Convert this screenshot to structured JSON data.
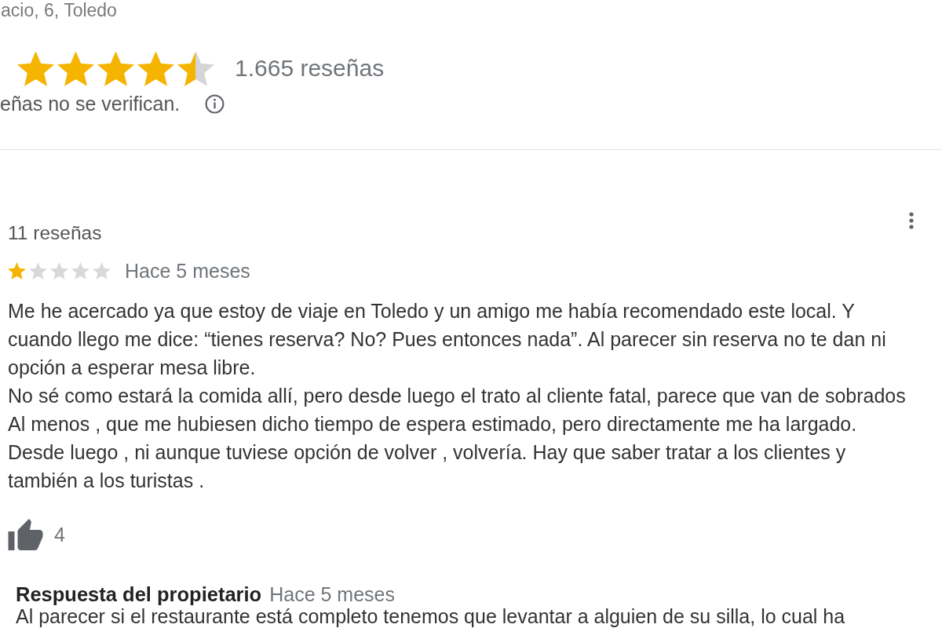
{
  "place_header": {
    "address": "acio, 6, Toledo",
    "stars": 4.5,
    "review_count": "1.665 reseñas",
    "notice": "eñas no se verifican."
  },
  "review": {
    "author_review_count": "11 reseñas",
    "stars": 1,
    "time": "Hace 5 meses",
    "paragraphs": [
      "Me he acercado ya que estoy de viaje en Toledo y un amigo me había recomendado este local. Y\ncuando llego me dice: “tienes reserva? No? Pues entonces nada”. Al parecer sin reserva no te dan ni\nopción a esperar mesa libre.",
      "No sé como estará la comida allí, pero desde luego el trato al cliente fatal, parece que van de sobrados",
      "Al menos , que me hubiesen dicho tiempo de espera estimado, pero directamente me ha largado.",
      "Desde luego , ni aunque tuviese opción de volver , volvería. Hay que saber tratar a los clientes y\ntambién a los turistas ."
    ],
    "likes": "4",
    "owner_reply": {
      "label": "Respuesta del propietario",
      "time": "Hace 5 meses",
      "text": "Al parecer si el restaurante está completo tenemos que levantar a alguien de su silla, lo cual ha"
    }
  }
}
